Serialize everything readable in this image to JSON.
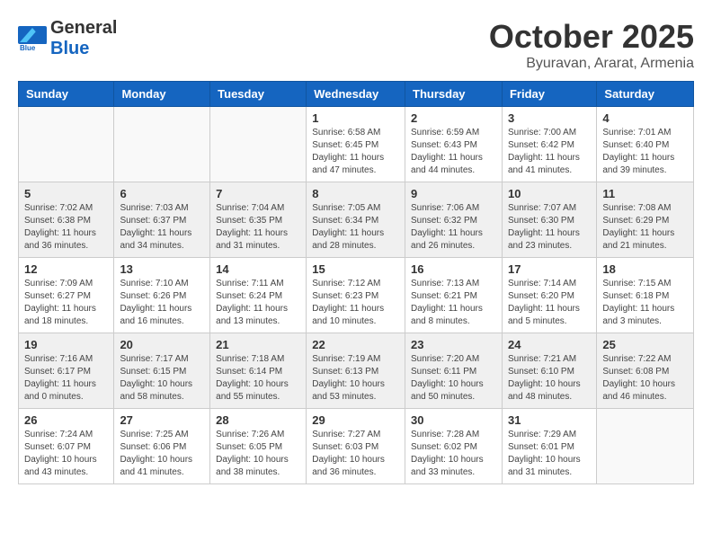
{
  "header": {
    "logo_general": "General",
    "logo_blue": "Blue",
    "month_year": "October 2025",
    "location": "Byuravan, Ararat, Armenia"
  },
  "weekdays": [
    "Sunday",
    "Monday",
    "Tuesday",
    "Wednesday",
    "Thursday",
    "Friday",
    "Saturday"
  ],
  "weeks": [
    [
      {
        "day": "",
        "info": ""
      },
      {
        "day": "",
        "info": ""
      },
      {
        "day": "",
        "info": ""
      },
      {
        "day": "1",
        "info": "Sunrise: 6:58 AM\nSunset: 6:45 PM\nDaylight: 11 hours\nand 47 minutes."
      },
      {
        "day": "2",
        "info": "Sunrise: 6:59 AM\nSunset: 6:43 PM\nDaylight: 11 hours\nand 44 minutes."
      },
      {
        "day": "3",
        "info": "Sunrise: 7:00 AM\nSunset: 6:42 PM\nDaylight: 11 hours\nand 41 minutes."
      },
      {
        "day": "4",
        "info": "Sunrise: 7:01 AM\nSunset: 6:40 PM\nDaylight: 11 hours\nand 39 minutes."
      }
    ],
    [
      {
        "day": "5",
        "info": "Sunrise: 7:02 AM\nSunset: 6:38 PM\nDaylight: 11 hours\nand 36 minutes."
      },
      {
        "day": "6",
        "info": "Sunrise: 7:03 AM\nSunset: 6:37 PM\nDaylight: 11 hours\nand 34 minutes."
      },
      {
        "day": "7",
        "info": "Sunrise: 7:04 AM\nSunset: 6:35 PM\nDaylight: 11 hours\nand 31 minutes."
      },
      {
        "day": "8",
        "info": "Sunrise: 7:05 AM\nSunset: 6:34 PM\nDaylight: 11 hours\nand 28 minutes."
      },
      {
        "day": "9",
        "info": "Sunrise: 7:06 AM\nSunset: 6:32 PM\nDaylight: 11 hours\nand 26 minutes."
      },
      {
        "day": "10",
        "info": "Sunrise: 7:07 AM\nSunset: 6:30 PM\nDaylight: 11 hours\nand 23 minutes."
      },
      {
        "day": "11",
        "info": "Sunrise: 7:08 AM\nSunset: 6:29 PM\nDaylight: 11 hours\nand 21 minutes."
      }
    ],
    [
      {
        "day": "12",
        "info": "Sunrise: 7:09 AM\nSunset: 6:27 PM\nDaylight: 11 hours\nand 18 minutes."
      },
      {
        "day": "13",
        "info": "Sunrise: 7:10 AM\nSunset: 6:26 PM\nDaylight: 11 hours\nand 16 minutes."
      },
      {
        "day": "14",
        "info": "Sunrise: 7:11 AM\nSunset: 6:24 PM\nDaylight: 11 hours\nand 13 minutes."
      },
      {
        "day": "15",
        "info": "Sunrise: 7:12 AM\nSunset: 6:23 PM\nDaylight: 11 hours\nand 10 minutes."
      },
      {
        "day": "16",
        "info": "Sunrise: 7:13 AM\nSunset: 6:21 PM\nDaylight: 11 hours\nand 8 minutes."
      },
      {
        "day": "17",
        "info": "Sunrise: 7:14 AM\nSunset: 6:20 PM\nDaylight: 11 hours\nand 5 minutes."
      },
      {
        "day": "18",
        "info": "Sunrise: 7:15 AM\nSunset: 6:18 PM\nDaylight: 11 hours\nand 3 minutes."
      }
    ],
    [
      {
        "day": "19",
        "info": "Sunrise: 7:16 AM\nSunset: 6:17 PM\nDaylight: 11 hours\nand 0 minutes."
      },
      {
        "day": "20",
        "info": "Sunrise: 7:17 AM\nSunset: 6:15 PM\nDaylight: 10 hours\nand 58 minutes."
      },
      {
        "day": "21",
        "info": "Sunrise: 7:18 AM\nSunset: 6:14 PM\nDaylight: 10 hours\nand 55 minutes."
      },
      {
        "day": "22",
        "info": "Sunrise: 7:19 AM\nSunset: 6:13 PM\nDaylight: 10 hours\nand 53 minutes."
      },
      {
        "day": "23",
        "info": "Sunrise: 7:20 AM\nSunset: 6:11 PM\nDaylight: 10 hours\nand 50 minutes."
      },
      {
        "day": "24",
        "info": "Sunrise: 7:21 AM\nSunset: 6:10 PM\nDaylight: 10 hours\nand 48 minutes."
      },
      {
        "day": "25",
        "info": "Sunrise: 7:22 AM\nSunset: 6:08 PM\nDaylight: 10 hours\nand 46 minutes."
      }
    ],
    [
      {
        "day": "26",
        "info": "Sunrise: 7:24 AM\nSunset: 6:07 PM\nDaylight: 10 hours\nand 43 minutes."
      },
      {
        "day": "27",
        "info": "Sunrise: 7:25 AM\nSunset: 6:06 PM\nDaylight: 10 hours\nand 41 minutes."
      },
      {
        "day": "28",
        "info": "Sunrise: 7:26 AM\nSunset: 6:05 PM\nDaylight: 10 hours\nand 38 minutes."
      },
      {
        "day": "29",
        "info": "Sunrise: 7:27 AM\nSunset: 6:03 PM\nDaylight: 10 hours\nand 36 minutes."
      },
      {
        "day": "30",
        "info": "Sunrise: 7:28 AM\nSunset: 6:02 PM\nDaylight: 10 hours\nand 33 minutes."
      },
      {
        "day": "31",
        "info": "Sunrise: 7:29 AM\nSunset: 6:01 PM\nDaylight: 10 hours\nand 31 minutes."
      },
      {
        "day": "",
        "info": ""
      }
    ]
  ]
}
